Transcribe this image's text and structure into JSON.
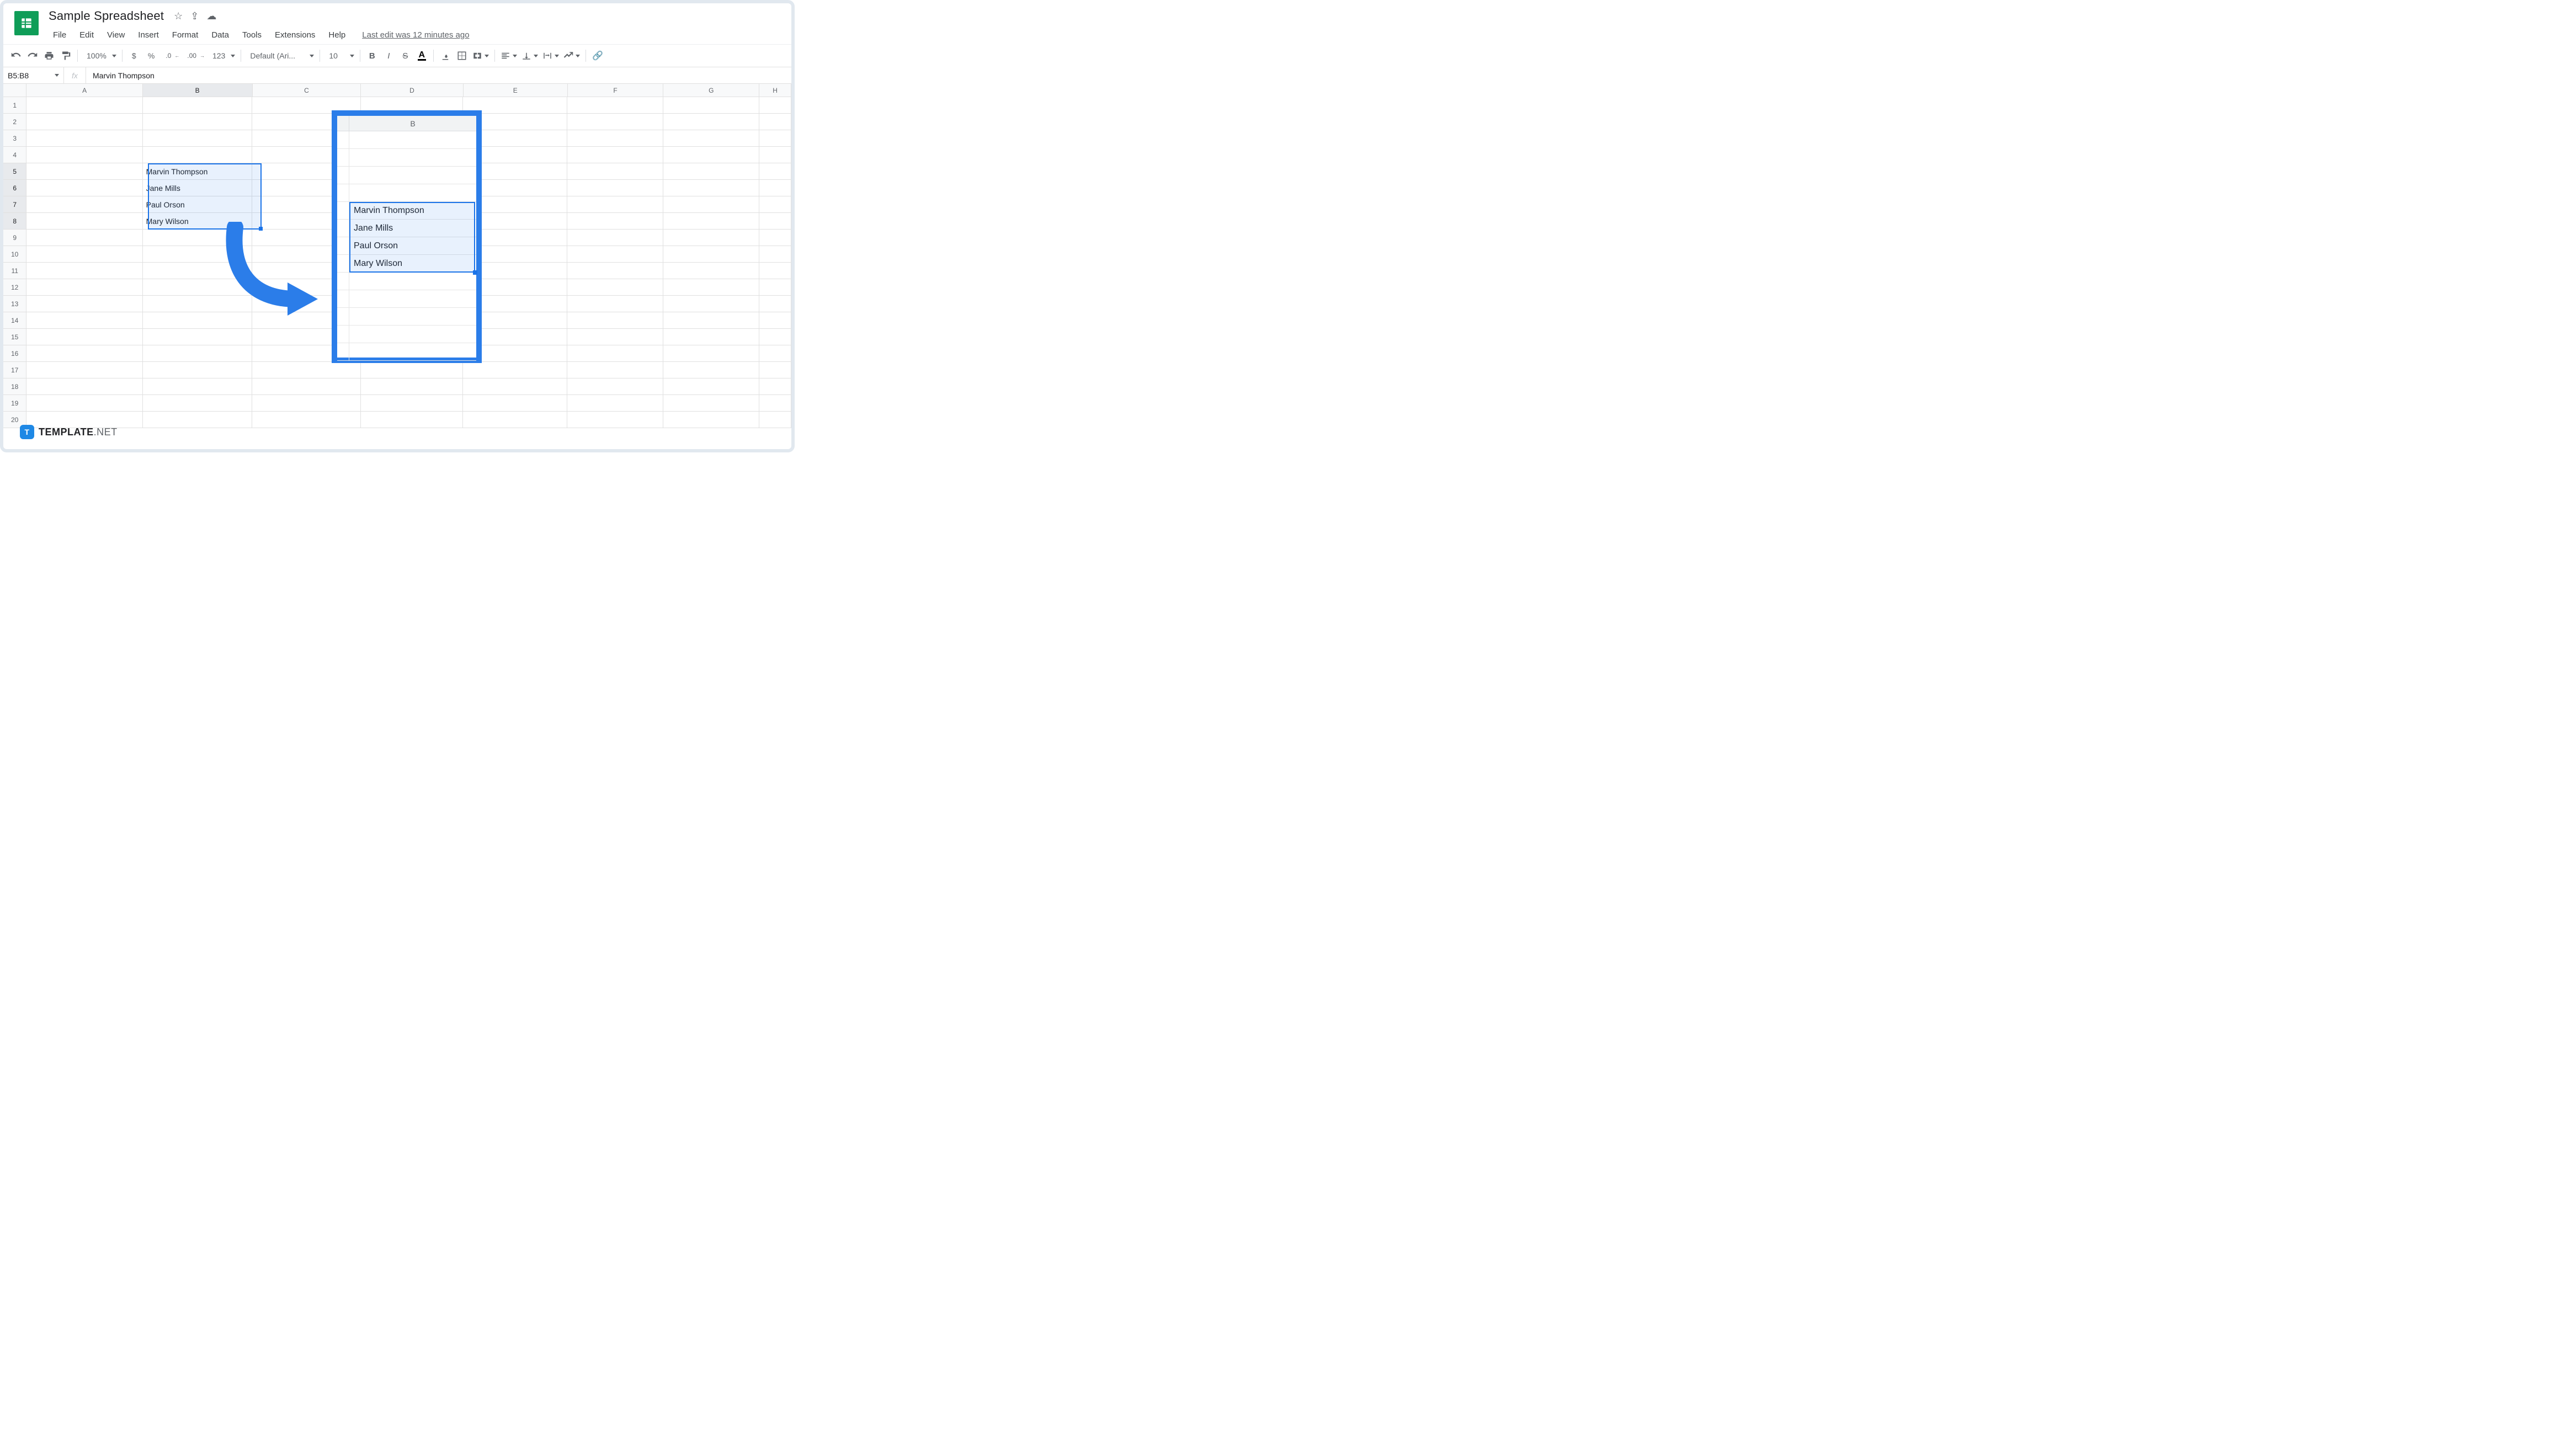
{
  "doc": {
    "title": "Sample Spreadsheet",
    "last_edit": "Last edit was 12 minutes ago"
  },
  "menu": {
    "file": "File",
    "edit": "Edit",
    "view": "View",
    "insert": "Insert",
    "format": "Format",
    "data": "Data",
    "tools": "Tools",
    "extensions": "Extensions",
    "help": "Help"
  },
  "toolbar": {
    "zoom": "100%",
    "currency": "$",
    "percent": "%",
    "dec_dec": ".0",
    "inc_dec": ".00",
    "more_fmt": "123",
    "font": "Default (Ari...",
    "font_size": "10",
    "bold": "B",
    "italic": "I",
    "strike": "S",
    "text_color": "A"
  },
  "formula": {
    "range": "B5:B8",
    "fx": "fx",
    "value": "Marvin Thompson"
  },
  "columns": [
    "A",
    "B",
    "C",
    "D",
    "E",
    "F",
    "G",
    "H"
  ],
  "rows": 20,
  "selected_rows": [
    5,
    6,
    7,
    8
  ],
  "cells": {
    "B5": "Marvin Thompson",
    "B6": "Jane Mills",
    "B7": "Paul Orson",
    "B8": "Mary Wilson"
  },
  "callout": {
    "col_label": "B",
    "values": [
      "Marvin Thompson",
      "Jane Mills",
      "Paul Orson",
      "Mary Wilson"
    ]
  },
  "watermark": {
    "bold": "TEMPLATE",
    "rest": ".NET",
    "badge": "T"
  }
}
